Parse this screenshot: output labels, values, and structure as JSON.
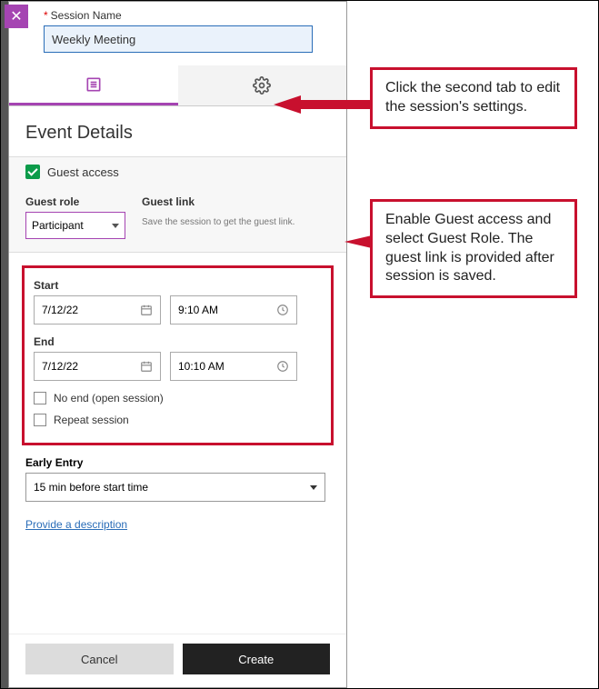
{
  "header": {
    "session_name_label": "Session Name",
    "session_name_value": "Weekly Meeting"
  },
  "section_title": "Event Details",
  "guest": {
    "access_label": "Guest access",
    "role_label": "Guest role",
    "role_value": "Participant",
    "link_label": "Guest link",
    "link_hint": "Save the session to get the guest link."
  },
  "start": {
    "label": "Start",
    "date": "7/12/22",
    "time": "9:10 AM"
  },
  "end": {
    "label": "End",
    "date": "7/12/22",
    "time": "10:10 AM"
  },
  "no_end_label": "No end (open session)",
  "repeat_label": "Repeat session",
  "early": {
    "label": "Early Entry",
    "value": "15 min before start time"
  },
  "desc_link": "Provide a description",
  "buttons": {
    "cancel": "Cancel",
    "create": "Create"
  },
  "callouts": {
    "c1": "Click the second tab to edit the session's settings.",
    "c2": "Enable Guest access and select Guest Role. The guest link is provided after session is saved."
  }
}
